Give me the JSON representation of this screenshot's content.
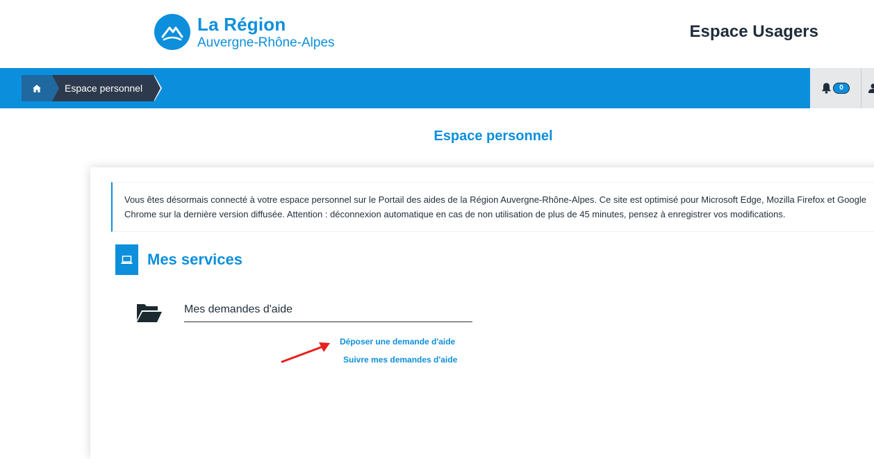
{
  "header": {
    "logo_title": "La Région",
    "logo_subtitle": "Auvergne-Rhône-Alpes",
    "app_title": "Espace Usagers"
  },
  "breadcrumb": {
    "home_icon": "home-icon",
    "current": "Espace personnel"
  },
  "toolbar": {
    "notifications_icon": "bell-icon",
    "notifications_count": "0",
    "user_icon": "user-icon"
  },
  "page": {
    "title": "Espace personnel"
  },
  "notice": {
    "text": "Vous êtes désormais connecté à votre espace personnel sur le Portail des aides de la Région Auvergne-Rhône-Alpes. Ce site est optimisé pour Microsoft Edge, Mozilla Firefox et Google Chrome sur la dernière version diffusée. Attention : déconnexion automatique en cas de non utilisation de plus de 45 minutes, pensez à enregistrer vos modifications."
  },
  "services": {
    "title": "Mes services",
    "icon": "laptop-icon",
    "demandes": {
      "title": "Mes demandes d'aide",
      "icon": "folder-open-icon",
      "links": {
        "deposer": "Déposer une demande d'aide",
        "suivre": "Suivre mes demandes d'aide"
      }
    }
  },
  "colors": {
    "brand_blue": "#0d8fdb",
    "bar_blue": "#0b8fdd",
    "dark": "#2d3a4d",
    "arrow_red": "#e8201e"
  }
}
